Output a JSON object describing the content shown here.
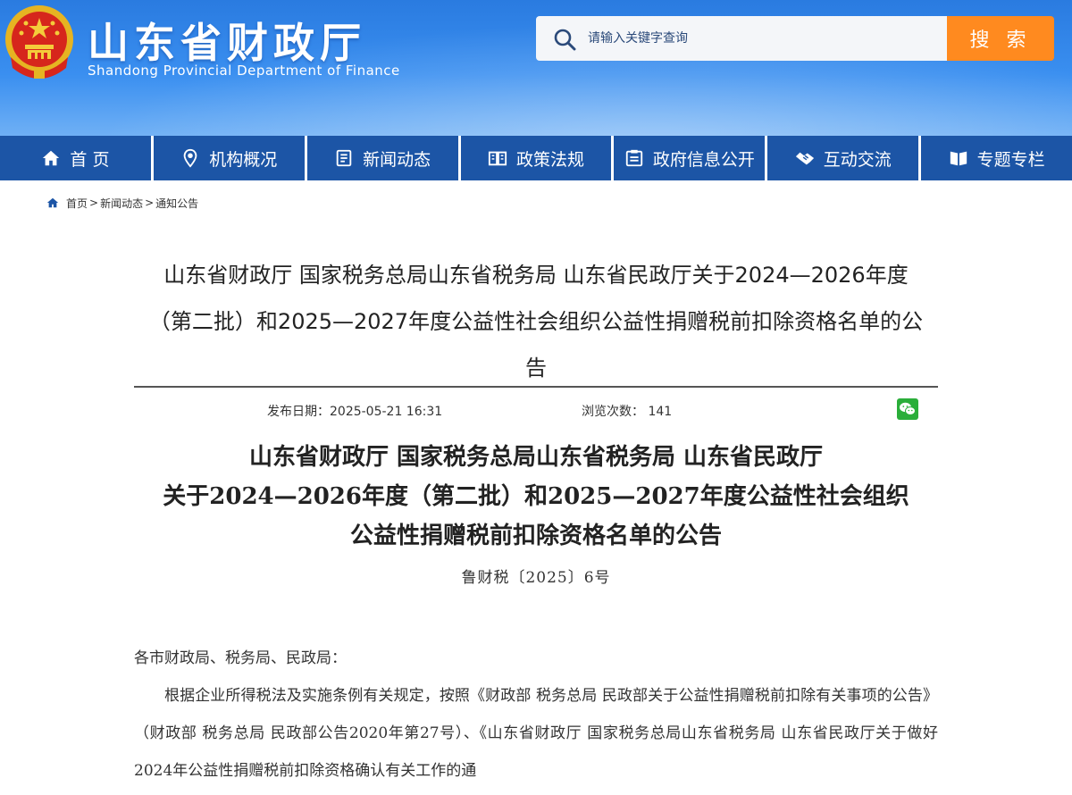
{
  "header": {
    "title": "山东省财政厅",
    "subtitle": "Shandong Provincial Department of Finance",
    "search_placeholder": "请输入关键字查询",
    "search_button": "搜 索"
  },
  "nav": {
    "items": [
      {
        "label": "首 页",
        "icon": "home-icon"
      },
      {
        "label": "机构概况",
        "icon": "location-pin-icon"
      },
      {
        "label": "新闻动态",
        "icon": "news-icon"
      },
      {
        "label": "政策法规",
        "icon": "book-icon"
      },
      {
        "label": "政府信息公开",
        "icon": "info-board-icon"
      },
      {
        "label": "互动交流",
        "icon": "handshake-icon"
      },
      {
        "label": "专题专栏",
        "icon": "open-book-icon"
      }
    ]
  },
  "breadcrumb": {
    "items": [
      "首页",
      "新闻动态",
      "通知公告"
    ],
    "separator": ">"
  },
  "article": {
    "title": "山东省财政厅 国家税务总局山东省税务局 山东省民政厅关于2024—2026年度（第二批）和2025—2027年度公益性社会组织公益性捐赠税前扣除资格名单的公告",
    "date_label": "发布日期：",
    "date": "2025-05-21 16:31",
    "views_label": "浏览次数：",
    "views": "141",
    "doc_title_lines": [
      "山东省财政厅 国家税务总局山东省税务局 山东省民政厅",
      "关于2024—2026年度（第二批）和2025—2027年度公益性社会组织",
      "公益性捐赠税前扣除资格名单的公告"
    ],
    "doc_number": "鲁财税〔2025〕6号",
    "salutation": "各市财政局、税务局、民政局：",
    "paragraph_1": "根据企业所得税法及实施条例有关规定，按照《财政部 税务总局 民政部关于公益性捐赠税前扣除有关事项的公告》（财政部 税务总局 民政部公告2020年第27号）、《山东省财政厅 国家税务总局山东省税务局 山东省民政厅关于做好2024年公益性捐赠税前扣除资格确认有关工作的通"
  },
  "colors": {
    "header_blue": "#2a7be0",
    "nav_blue": "#1c55a6",
    "search_orange": "#ff8a1f",
    "wechat_green": "#2aae3a"
  }
}
